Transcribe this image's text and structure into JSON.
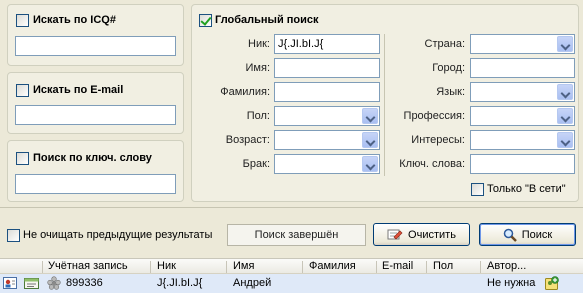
{
  "left_panel": {
    "icq": {
      "label": "Искать по ICQ#",
      "checked": false,
      "value": ""
    },
    "email": {
      "label": "Искать по E-mail",
      "checked": false,
      "value": ""
    },
    "keyword": {
      "label": "Поиск по ключ. слову",
      "checked": false,
      "value": ""
    }
  },
  "global_search": {
    "label": "Глобальный поиск",
    "checked": true,
    "fields_left": [
      {
        "label": "Ник:",
        "value": "J{.JI.bI.J{",
        "type": "text"
      },
      {
        "label": "Имя:",
        "value": "",
        "type": "text"
      },
      {
        "label": "Фамилия:",
        "value": "",
        "type": "text"
      },
      {
        "label": "Пол:",
        "value": "",
        "type": "combo"
      },
      {
        "label": "Возраст:",
        "value": "",
        "type": "combo"
      },
      {
        "label": "Брак:",
        "value": "",
        "type": "combo"
      }
    ],
    "fields_right": [
      {
        "label": "Страна:",
        "value": "",
        "type": "combo"
      },
      {
        "label": "Город:",
        "value": "",
        "type": "text"
      },
      {
        "label": "Язык:",
        "value": "",
        "type": "combo"
      },
      {
        "label": "Профессия:",
        "value": "",
        "type": "combo"
      },
      {
        "label": "Интересы:",
        "value": "",
        "type": "combo"
      },
      {
        "label": "Ключ. слова:",
        "value": "",
        "type": "text"
      }
    ],
    "online_only": {
      "label": "Только \"В сети\"",
      "checked": false
    }
  },
  "bottom_bar": {
    "keep_results": {
      "label": "Не очищать предыдущие результаты",
      "checked": false
    },
    "status": "Поиск завершён",
    "clear_button": "Очистить",
    "search_button": "Поиск"
  },
  "results": {
    "columns": [
      "Учётная запись",
      "Ник",
      "Имя",
      "Фамилия",
      "E-mail",
      "Пол",
      "Автор..."
    ],
    "rows": [
      {
        "account": "899336",
        "nick": "J{.JI.bI.J{",
        "first_name": "Андрей",
        "last_name": "",
        "email": "",
        "gender": "",
        "auth": "Не нужна"
      }
    ]
  },
  "icons": {
    "row_user": "user-card-icon",
    "row_info": "info-card-icon",
    "row_status": "status-flower-icon",
    "row_add": "add-contact-icon",
    "clear": "eraser-icon",
    "search": "magnifier-icon"
  },
  "colors": {
    "selection_row": "#dfe9f8",
    "window_bg": "#ece9d8",
    "checkbox_check": "#21a121"
  }
}
